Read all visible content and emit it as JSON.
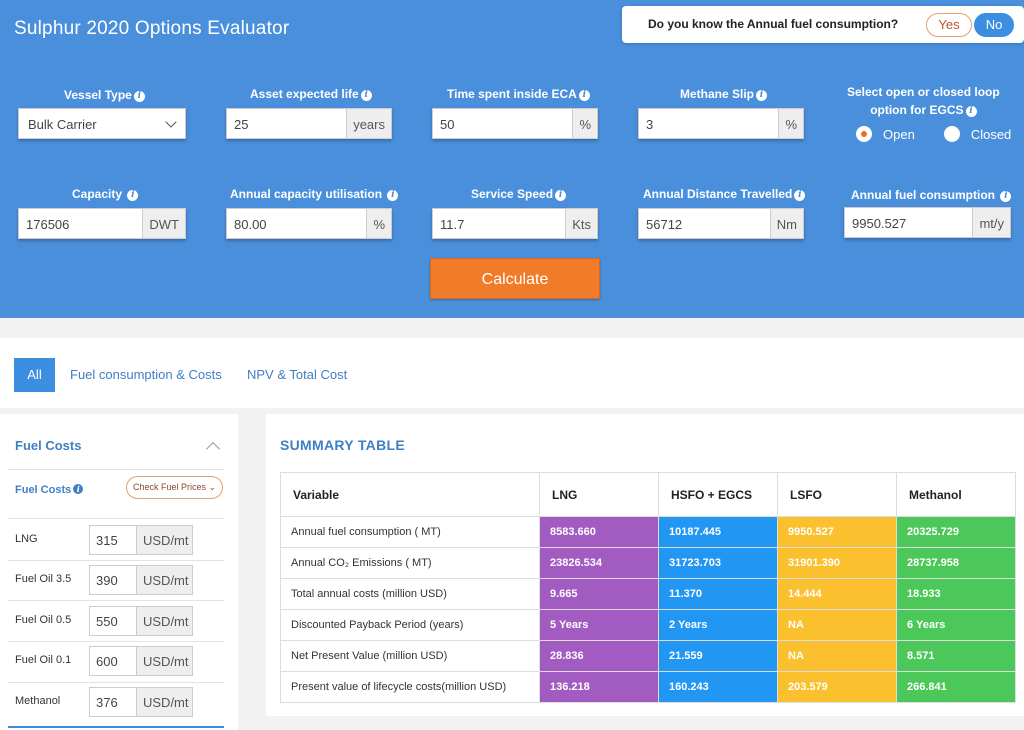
{
  "header": {
    "title": "Sulphur 2020 Options Evaluator",
    "question": "Do you know the Annual fuel consumption?",
    "yes_label": "Yes",
    "no_label": "No"
  },
  "inputs": {
    "vessel_type": {
      "label": "Vessel Type",
      "value": "Bulk Carrier"
    },
    "asset_life": {
      "label": "Asset expected life",
      "value": "25",
      "unit": "years"
    },
    "eca_time": {
      "label": "Time spent inside ECA",
      "value": "50",
      "unit": "%"
    },
    "methane_slip": {
      "label": "Methane Slip",
      "value": "3",
      "unit": "%"
    },
    "loop_option": {
      "label_line1": "Select open or closed loop",
      "label_line2": "option for EGCS",
      "open_label": "Open",
      "closed_label": "Closed",
      "selected": "Open"
    },
    "capacity": {
      "label": "Capacity",
      "value": "176506",
      "unit": "DWT"
    },
    "utilisation": {
      "label": "Annual capacity utilisation",
      "value": "80.00",
      "unit": "%"
    },
    "service_speed": {
      "label": "Service Speed",
      "value": "11.7",
      "unit": "Kts"
    },
    "distance": {
      "label": "Annual Distance Travelled",
      "value": "56712",
      "unit": "Nm"
    },
    "fuel_consumption": {
      "label": "Annual fuel consumption",
      "value": "9950.527",
      "unit": "mt/y"
    }
  },
  "calculate_label": "Calculate",
  "tabs": [
    {
      "label": "All"
    },
    {
      "label": "Fuel consumption & Costs"
    },
    {
      "label": "NPV & Total Cost"
    }
  ],
  "fuel_panel": {
    "title": "Fuel Costs",
    "subtitle": "Fuel Costs",
    "check_prices_label": "Check Fuel Prices",
    "rows": [
      {
        "name": "LNG",
        "value": "315",
        "unit": "USD/mt"
      },
      {
        "name": "Fuel Oil 3.5",
        "value": "390",
        "unit": "USD/mt"
      },
      {
        "name": "Fuel Oil 0.5",
        "value": "550",
        "unit": "USD/mt"
      },
      {
        "name": "Fuel Oil 0.1",
        "value": "600",
        "unit": "USD/mt"
      },
      {
        "name": "Methanol",
        "value": "376",
        "unit": "USD/mt"
      }
    ]
  },
  "summary": {
    "title": "SUMMARY TABLE",
    "headers": [
      "Variable",
      "LNG",
      "HSFO + EGCS",
      "LSFO",
      "Methanol"
    ],
    "rows": [
      {
        "variable": "Annual fuel consumption ( MT)",
        "values": [
          "8583.660",
          "10187.445",
          "9950.527",
          "20325.729"
        ]
      },
      {
        "variable": "Annual CO₂ Emissions ( MT)",
        "values": [
          "23826.534",
          "31723.703",
          "31901.390",
          "28737.958"
        ]
      },
      {
        "variable": "Total annual costs (million USD)",
        "values": [
          "9.665",
          "11.370",
          "14.444",
          "18.933"
        ]
      },
      {
        "variable": "Discounted Payback Period (years)",
        "values": [
          "5 Years",
          "2 Years",
          "NA",
          "6 Years"
        ]
      },
      {
        "variable": "Net Present Value (million USD)",
        "values": [
          "28.836",
          "21.559",
          "NA",
          "8.571"
        ]
      },
      {
        "variable": "Present value of lifecycle costs(million USD)",
        "values": [
          "136.218",
          "160.243",
          "203.579",
          "266.841"
        ]
      }
    ],
    "column_colors": [
      "#a25bc0",
      "#2196f3",
      "#fbc02d",
      "#4cc759"
    ]
  }
}
